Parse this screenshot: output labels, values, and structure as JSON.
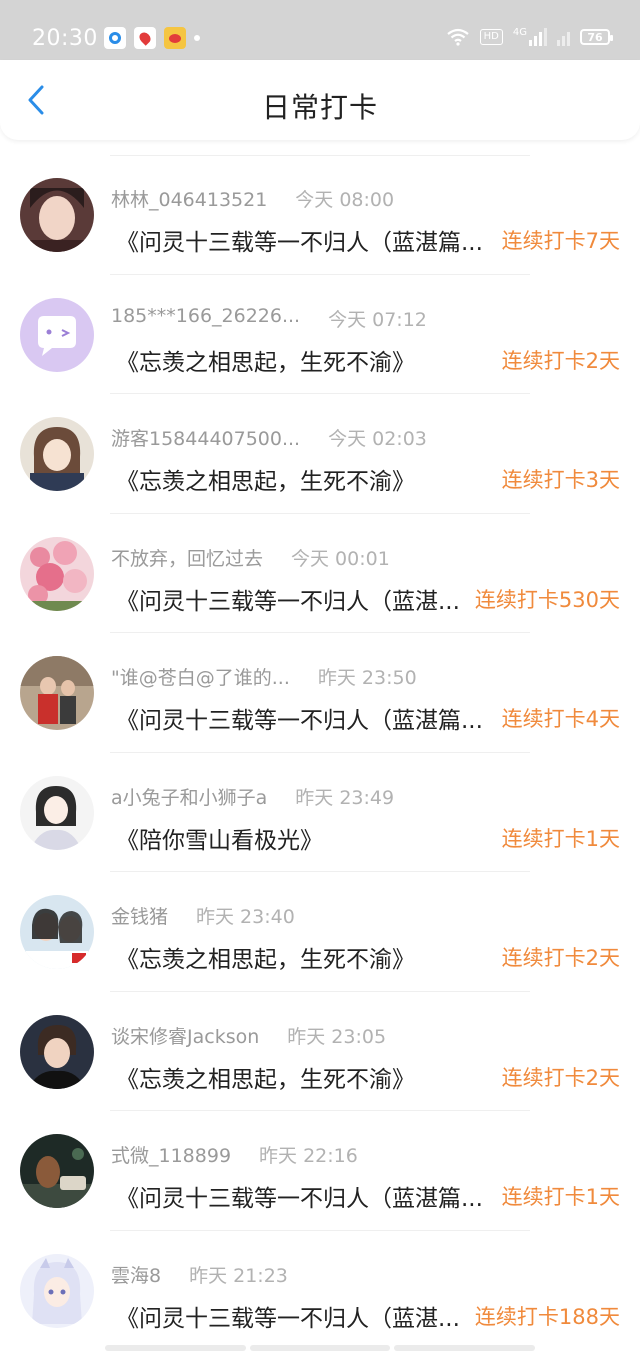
{
  "status_bar": {
    "time": "20:30",
    "hd": "HD",
    "network": "4G",
    "battery": "76"
  },
  "nav": {
    "title": "日常打卡"
  },
  "rows": [
    {
      "name": "林林_046413521",
      "time": "今天 08:00",
      "title": "《问灵十三载等一不归人（蓝湛篇...",
      "streak": "连续打卡7天"
    },
    {
      "name": "185***166_26226...",
      "time": "今天 07:12",
      "title": "《忘羡之相思起，生死不渝》",
      "streak": "连续打卡2天"
    },
    {
      "name": "游客15844407500...",
      "time": "今天 02:03",
      "title": "《忘羡之相思起，生死不渝》",
      "streak": "连续打卡3天"
    },
    {
      "name": "不放弃，回忆过去",
      "time": "今天 00:01",
      "title": "《问灵十三载等一不归人（蓝湛...",
      "streak": "连续打卡530天"
    },
    {
      "name": "\"谁@苍白@了谁的...",
      "time": "昨天 23:50",
      "title": "《问灵十三载等一不归人（蓝湛篇...",
      "streak": "连续打卡4天"
    },
    {
      "name": "a小兔子和小狮子a",
      "time": "昨天 23:49",
      "title": "《陪你雪山看极光》",
      "streak": "连续打卡1天"
    },
    {
      "name": "金钱猪",
      "time": "昨天 23:40",
      "title": "《忘羡之相思起，生死不渝》",
      "streak": "连续打卡2天"
    },
    {
      "name": "谈宋修睿Jackson",
      "time": "昨天 23:05",
      "title": "《忘羡之相思起，生死不渝》",
      "streak": "连续打卡2天"
    },
    {
      "name": "式微_118899",
      "time": "昨天 22:16",
      "title": "《问灵十三载等一不归人（蓝湛篇...",
      "streak": "连续打卡1天"
    },
    {
      "name": "雲海8",
      "time": "昨天 21:23",
      "title": "《问灵十三载等一不归人（蓝湛...",
      "streak": "连续打卡188天"
    }
  ],
  "colors": {
    "accent_orange": "#f08a3c",
    "back_blue": "#2a8de8",
    "status_bar_bg": "#d4d4d4"
  }
}
